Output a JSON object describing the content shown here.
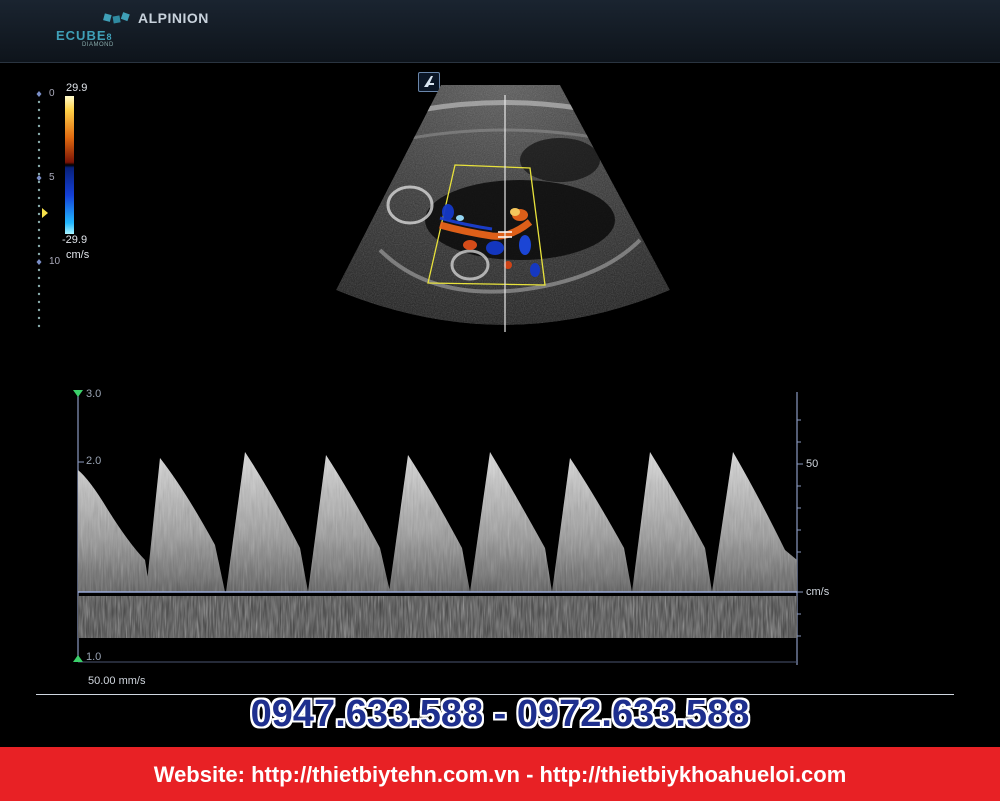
{
  "header": {
    "brand": "ECUBE",
    "brand_model": "8",
    "brand_edition": "DIAMOND",
    "app_name": "ALPINION"
  },
  "depth_scale": {
    "labels": [
      "0",
      "5",
      "10"
    ]
  },
  "color_scale": {
    "max": "29.9",
    "min": "-29.9",
    "unit": "cm/s"
  },
  "probe_marker": {
    "glyph": "⁄"
  },
  "doppler": {
    "left_scale_top": "3.0",
    "left_scale_mid": "2.0",
    "left_scale_bottom": "1.0",
    "right_scale_value": "50",
    "right_scale_unit": "cm/s",
    "sweep_speed": "50.00 mm/s"
  },
  "contact": {
    "phones": "0947.633.588 - 0972.633.588",
    "website": "Website: http://thietbiytehn.com.vn - http://thietbiykhoahueloi.com"
  },
  "colors": {
    "footer_bg": "#e82125",
    "phone_text": "#1e2f8e"
  }
}
